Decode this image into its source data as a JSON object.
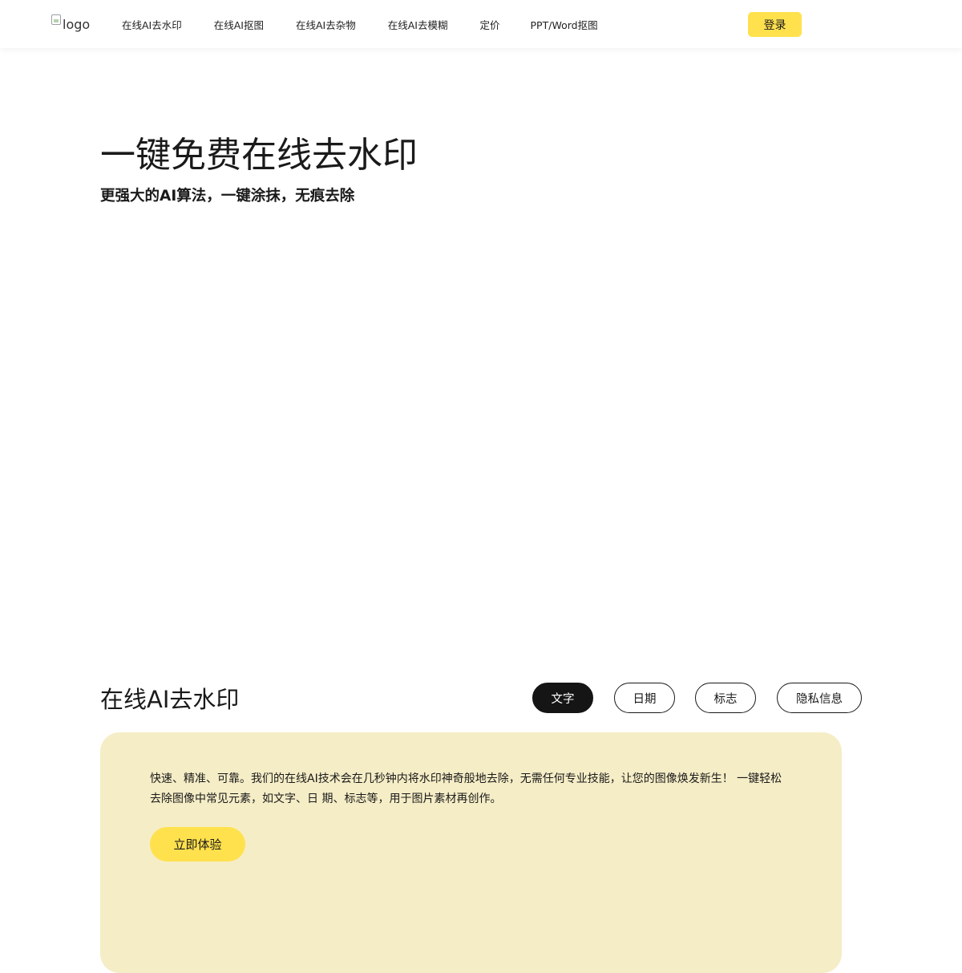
{
  "header": {
    "logo_alt": "logo",
    "nav": [
      {
        "label": "在线AI去水印"
      },
      {
        "label": "在线AI抠图"
      },
      {
        "label": "在线AI去杂物"
      },
      {
        "label": "在线AI去模糊"
      },
      {
        "label": "定价"
      },
      {
        "label": "PPT/Word抠图"
      }
    ],
    "login_label": "登录"
  },
  "hero": {
    "title": "一键免费在线去水印",
    "subtitle": "更强大的AI算法，一键涂抹，无痕去除"
  },
  "section": {
    "title": "在线AI去水印",
    "tabs": [
      {
        "label": "文字",
        "active": true
      },
      {
        "label": "日期",
        "active": false
      },
      {
        "label": "标志",
        "active": false
      },
      {
        "label": "隐私信息",
        "active": false
      }
    ],
    "card": {
      "description": "快速、精准、可靠。我们的在线AI技术会在几秒钟内将水印神奇般地去除，无需任何专业技能，让您的图像焕发新生！ 一键轻松去除图像中常见元素，如文字、日 期、标志等，用于图片素材再创作。",
      "cta_label": "立即体验"
    }
  },
  "colors": {
    "accent_yellow": "#ffe14d",
    "card_background": "#f5edc6",
    "active_tab": "#151515"
  }
}
